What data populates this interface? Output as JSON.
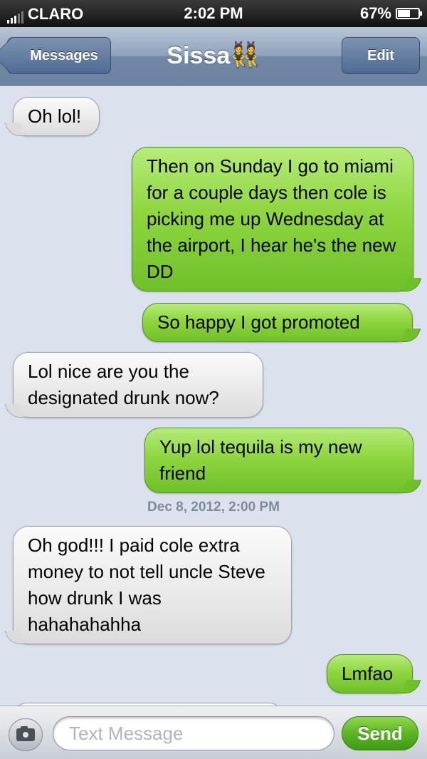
{
  "status_bar": {
    "carrier": "CLARO",
    "time": "2:02 PM",
    "battery_percent": "67%",
    "battery_level": 0.67
  },
  "nav": {
    "back_label": "Messages",
    "title": "Sissa👯",
    "edit_label": "Edit"
  },
  "messages": [
    {
      "direction": "incoming",
      "text": "Oh lol!"
    },
    {
      "direction": "outgoing",
      "text": "Then on Sunday I go to miami for a couple days then cole is picking me up Wednesday at the airport, I hear he's the new DD"
    },
    {
      "direction": "outgoing",
      "text": "So happy I got promoted"
    },
    {
      "direction": "incoming",
      "text": "Lol nice are you the designated drunk now?"
    },
    {
      "direction": "outgoing",
      "text": "Yup lol tequila is my new friend"
    },
    {
      "direction": "incoming",
      "text": "Oh god!!! I paid cole extra money to not tell uncle Steve how drunk I was hahahahahha"
    },
    {
      "direction": "outgoing",
      "text": "Lmfao"
    }
  ],
  "timestamp": "Dec 8, 2012, 2:00 PM",
  "composer": {
    "placeholder": "Text Message",
    "send_label": "Send",
    "camera_icon": "camera-icon"
  }
}
